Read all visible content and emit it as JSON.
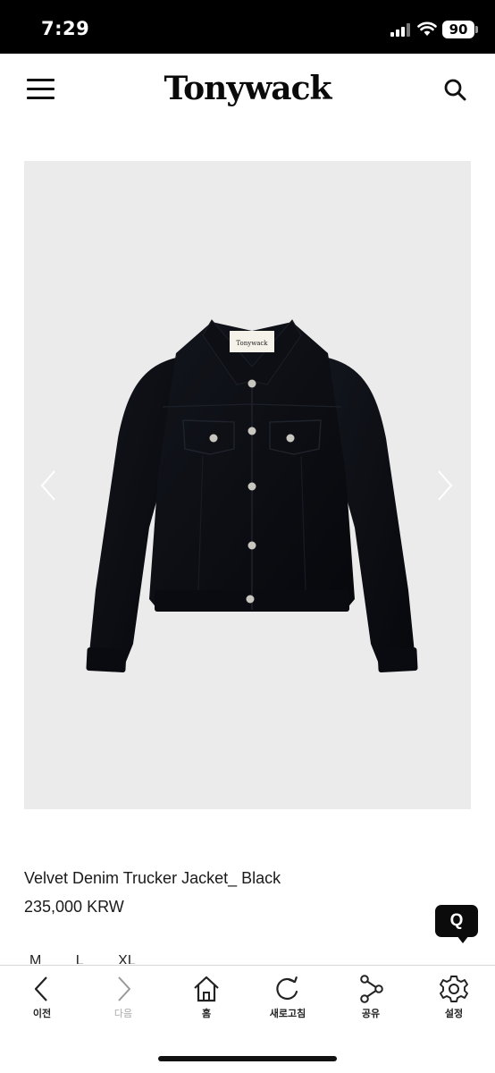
{
  "status_bar": {
    "time": "7:29",
    "battery": "90"
  },
  "header": {
    "brand": "Tonywack"
  },
  "product": {
    "name": "Velvet Denim Trucker Jacket_ Black",
    "price": "235,000 KRW",
    "label_text": "Tonywack",
    "sizes": [
      "M",
      "L",
      "XL"
    ]
  },
  "floating": {
    "q_label": "Q"
  },
  "bottom_nav": [
    {
      "label": "이전",
      "icon": "chevron-left-icon"
    },
    {
      "label": "다음",
      "icon": "chevron-right-icon"
    },
    {
      "label": "홈",
      "icon": "home-icon"
    },
    {
      "label": "새로고침",
      "icon": "refresh-icon"
    },
    {
      "label": "공유",
      "icon": "share-icon"
    },
    {
      "label": "설정",
      "icon": "gear-icon"
    }
  ],
  "colors": {
    "status_bar": "#000000",
    "image_bg": "#ebebeb",
    "jacket": "#0c0e14",
    "accent": "#0b0b0b"
  }
}
